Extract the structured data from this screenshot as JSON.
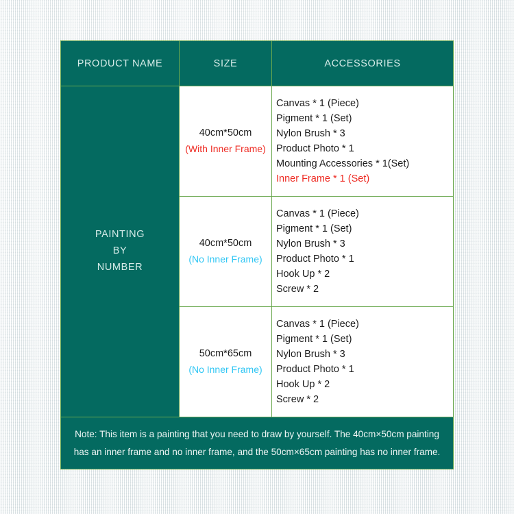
{
  "table": {
    "headers": {
      "product_name": "PRODUCT NAME",
      "size": "SIZE",
      "accessories": "ACCESSORIES"
    },
    "product_name": "PAINTING\nBY\nNUMBER",
    "rows": [
      {
        "size": "40cm*50cm",
        "size_note": "(With Inner Frame)",
        "size_note_color": "#ee2c24",
        "accessories": [
          {
            "text": "Canvas * 1 (Piece)",
            "color": "#1b1b1b"
          },
          {
            "text": "Pigment * 1 (Set)",
            "color": "#1b1b1b"
          },
          {
            "text": "Nylon Brush * 3",
            "color": "#1b1b1b"
          },
          {
            "text": "Product Photo * 1",
            "color": "#1b1b1b"
          },
          {
            "text": "Mounting Accessories * 1(Set)",
            "color": "#1b1b1b"
          },
          {
            "text": "Inner Frame * 1 (Set)",
            "color": "#ee2c24"
          }
        ]
      },
      {
        "size": "40cm*50cm",
        "size_note": "(No Inner Frame)",
        "size_note_color": "#2fc6f4",
        "accessories": [
          {
            "text": "Canvas * 1 (Piece)",
            "color": "#1b1b1b"
          },
          {
            "text": "Pigment * 1 (Set)",
            "color": "#1b1b1b"
          },
          {
            "text": "Nylon Brush * 3",
            "color": "#1b1b1b"
          },
          {
            "text": "Product Photo * 1",
            "color": "#1b1b1b"
          },
          {
            "text": "Hook Up * 2",
            "color": "#1b1b1b"
          },
          {
            "text": "Screw * 2",
            "color": "#1b1b1b"
          }
        ]
      },
      {
        "size": "50cm*65cm",
        "size_note": "(No Inner Frame)",
        "size_note_color": "#2fc6f4",
        "accessories": [
          {
            "text": "Canvas * 1 (Piece)",
            "color": "#1b1b1b"
          },
          {
            "text": "Pigment * 1 (Set)",
            "color": "#1b1b1b"
          },
          {
            "text": "Nylon Brush * 3",
            "color": "#1b1b1b"
          },
          {
            "text": "Product Photo * 1",
            "color": "#1b1b1b"
          },
          {
            "text": "Hook Up * 2",
            "color": "#1b1b1b"
          },
          {
            "text": "Screw * 2",
            "color": "#1b1b1b"
          }
        ]
      }
    ],
    "note": "Note: This item is a painting that you need to draw by yourself. The 40cm×50cm painting has an inner frame and no inner frame, and the 50cm×65cm painting has no inner frame."
  },
  "colors": {
    "teal": "#046a60",
    "border_green": "#6aa84f",
    "header_text": "#d6ece9",
    "body_text": "#1b1b1b",
    "accent_red": "#ee2c24",
    "accent_cyan": "#2fc6f4",
    "page_background": "#e8edee"
  }
}
